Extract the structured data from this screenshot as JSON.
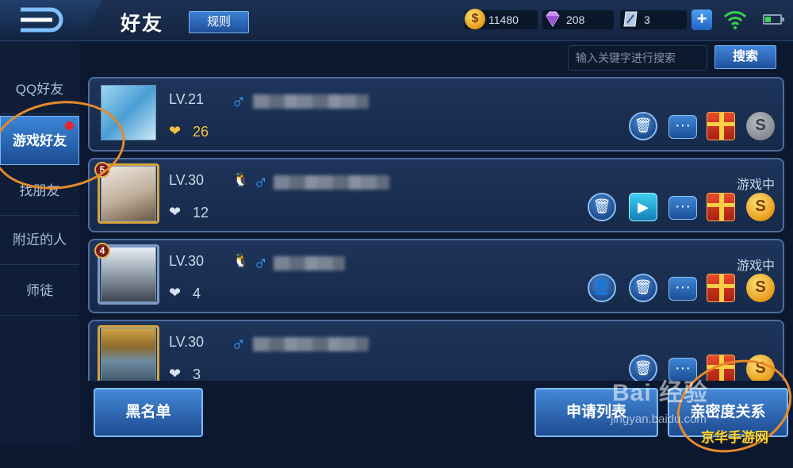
{
  "header": {
    "title": "好友",
    "rules_label": "规则",
    "currencies": [
      {
        "icon": "gold-coin-icon",
        "value": "11480"
      },
      {
        "icon": "diamond-icon",
        "value": "208"
      },
      {
        "icon": "voucher-icon",
        "value": "3"
      }
    ]
  },
  "sidebar": {
    "items": [
      {
        "label": "QQ好友"
      },
      {
        "label": "游戏好友"
      },
      {
        "label": "找朋友"
      },
      {
        "label": "附近的人"
      },
      {
        "label": "师徒"
      }
    ]
  },
  "search": {
    "placeholder": "输入关键字进行搜索",
    "button_label": "搜索"
  },
  "friends": [
    {
      "level": "LV.21",
      "intimacy": "26",
      "status": "",
      "rank": ""
    },
    {
      "level": "LV.30",
      "intimacy": "12",
      "status": "游戏中",
      "rank": "5"
    },
    {
      "level": "LV.30",
      "intimacy": "4",
      "status": "游戏中",
      "rank": "4"
    },
    {
      "level": "LV.30",
      "intimacy": "3",
      "status": "",
      "rank": ""
    }
  ],
  "bottom": {
    "blacklist_label": "黑名单",
    "requests_label": "申请列表",
    "intimacy_label": "亲密度关系"
  },
  "watermarks": {
    "baidu": "Bai 经验",
    "baidu_url": "jingyan.baidu.com",
    "corner": "京华手游网"
  },
  "colors": {
    "accent": "#3a86d8",
    "circle_annotation": "#e58a2a",
    "gold": "#f0c23e"
  }
}
